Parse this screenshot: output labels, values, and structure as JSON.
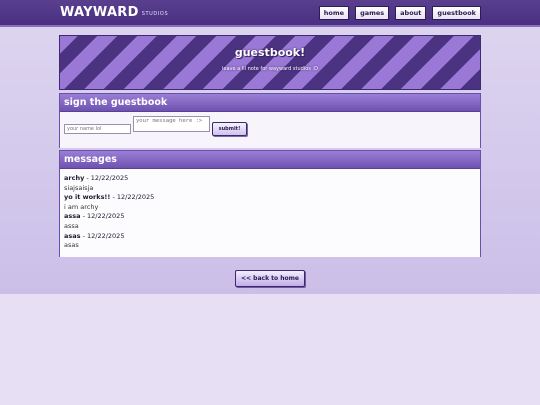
{
  "header": {
    "logo": "WAYWARD",
    "logo_sub": "STUDIOS",
    "nav": [
      {
        "label": "home"
      },
      {
        "label": "games"
      },
      {
        "label": "about"
      },
      {
        "label": "guestbook"
      }
    ]
  },
  "banner": {
    "title": "guestbook!",
    "subtitle": "leave a lil note for wayward studios :D"
  },
  "sign": {
    "heading": "sign the guestbook",
    "name_placeholder": "your name lol",
    "message_placeholder": "your message here :>",
    "submit_label": "submit!"
  },
  "messages": {
    "heading": "messages",
    "entries": [
      {
        "author": "archy",
        "date": " - 12/22/2025",
        "text": "siajsaisja"
      },
      {
        "author": "yo it works!!",
        "date": " - 12/22/2025",
        "text": "i am archy"
      },
      {
        "author": "assa",
        "date": " - 12/22/2025",
        "text": "assa"
      },
      {
        "author": "asas",
        "date": " - 12/22/2025",
        "text": "asas"
      }
    ]
  },
  "footer": {
    "back_label": "<< back to home"
  },
  "colors": {
    "header_bg": "#4a3080",
    "stripe_dark": "#4b3381",
    "stripe_light": "#9a78d6",
    "panel_head": "#7a5dc0",
    "page_bg": "#e7e0f4"
  }
}
